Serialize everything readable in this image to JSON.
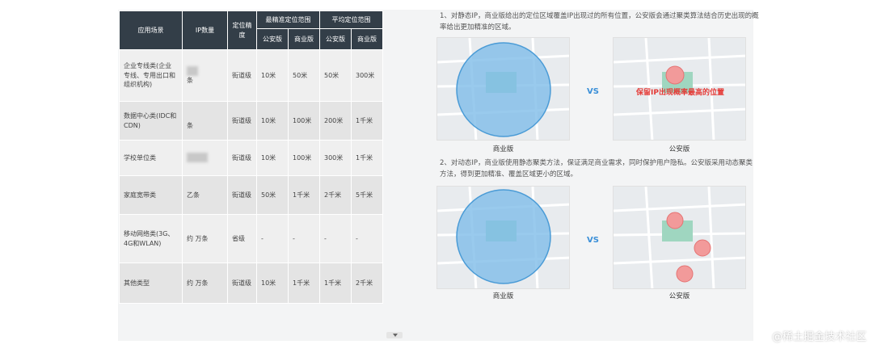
{
  "table": {
    "headers": {
      "scene": "应用场景",
      "ip_count": "IP数量",
      "precision": "定位精度",
      "best_range": "最精准定位范围",
      "avg_range": "平均定位范围",
      "police": "公安版",
      "commercial": "商业版"
    },
    "rows": [
      {
        "scene": "企业专线类(企业专线、专用出口和组织机构)",
        "count": "条",
        "precision": "街道级",
        "best_police": "10米",
        "best_com": "50米",
        "avg_police": "50米",
        "avg_com": "300米"
      },
      {
        "scene": "数据中心类(IDC和CDN)",
        "count": "条",
        "precision": "街道级",
        "best_police": "10米",
        "best_com": "100米",
        "avg_police": "200米",
        "avg_com": "1千米"
      },
      {
        "scene": "学校单位类",
        "count": "",
        "precision": "街道级",
        "best_police": "10米",
        "best_com": "100米",
        "avg_police": "300米",
        "avg_com": "1千米"
      },
      {
        "scene": "家庭宽带类",
        "count": "乙条",
        "precision": "街道级",
        "best_police": "50米",
        "best_com": "1千米",
        "avg_police": "2千米",
        "avg_com": "5千米"
      },
      {
        "scene": "移动网络类(3G、4G和WLAN)",
        "count": "约 万条",
        "precision": "省级",
        "best_police": "-",
        "best_com": "-",
        "avg_police": "-",
        "avg_com": "-"
      },
      {
        "scene": "其他类型",
        "count": "约 万条",
        "precision": "街道级",
        "best_police": "10米",
        "best_com": "1千米",
        "avg_police": "1千米",
        "avg_com": "2千米"
      }
    ]
  },
  "panel": {
    "desc1": "1、对静态IP，商业版给出的定位区域覆盖IP出现过的所有位置，公安版会通过聚类算法结合历史出现的概率给出更加精准的区域。",
    "desc2": "2、对动态IP，商业版使用静态聚类方法，保证满足商业需求，同时保护用户隐私。公安版采用动态聚类方法，得到更加精准、覆盖区域更小的区域。",
    "vs": "VS",
    "caption_commercial": "商业版",
    "caption_police": "公安版",
    "highlight": "保留IP出现概率最高的位置"
  },
  "watermark": "@稀土掘金技术社区",
  "colors": {
    "header_bg": "#333e48",
    "circle_fill": "#7fbde8",
    "circle_stroke": "#4a9bd6",
    "police_circle": "#f29a9a",
    "highlight_red": "#e53935",
    "vs_blue": "#3a8fd8"
  }
}
